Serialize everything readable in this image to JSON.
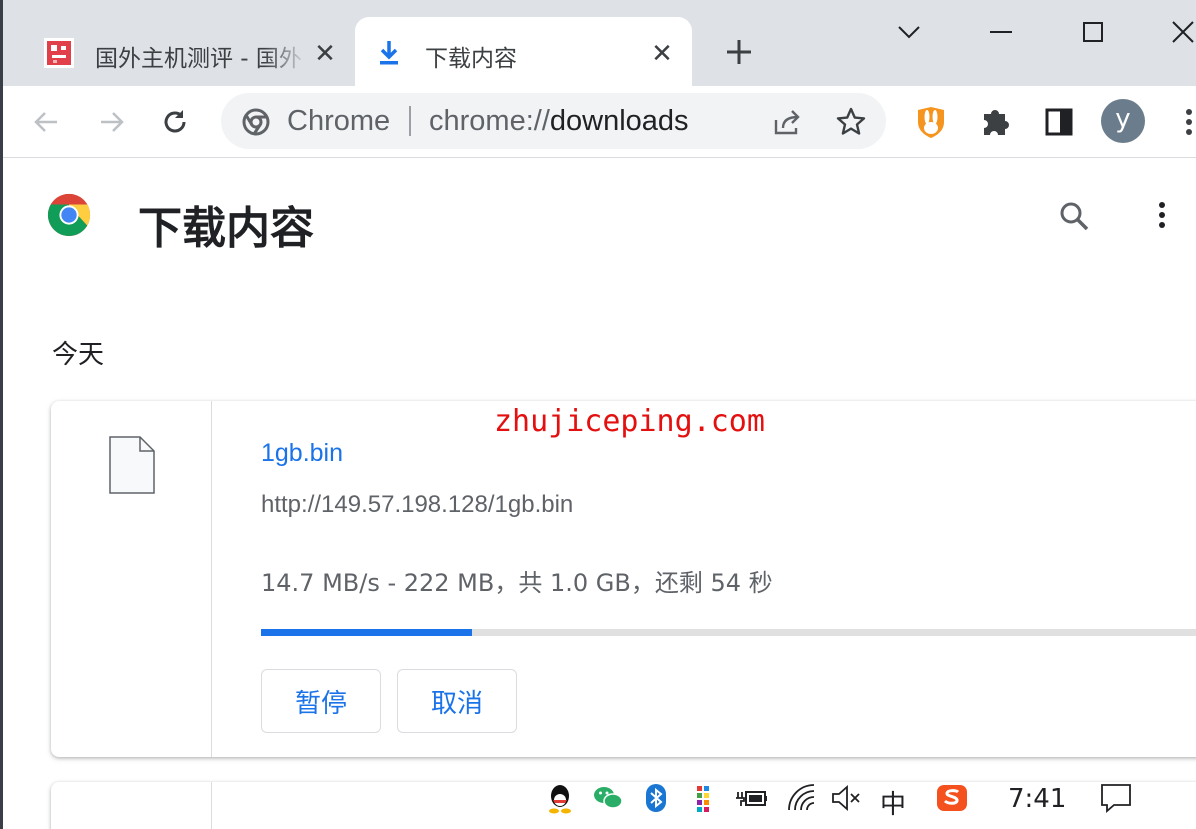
{
  "tabs": [
    {
      "title": "国外主机测评 - 国外",
      "active": false,
      "favicon": "site-favicon"
    },
    {
      "title": "下载内容",
      "active": true,
      "favicon": "download-icon"
    }
  ],
  "omnibox": {
    "chip": "Chrome",
    "url_scheme": "chrome://",
    "url_path": "downloads"
  },
  "profile": {
    "initial": "y"
  },
  "page": {
    "title": "下载内容",
    "date_heading": "今天"
  },
  "download": {
    "file_name": "1gb.bin",
    "url": "http://149.57.198.128/1gb.bin",
    "status": "14.7 MB/s - 222 MB，共 1.0 GB，还剩 54 秒",
    "progress_fraction": 0.222,
    "pause_label": "暂停",
    "cancel_label": "取消"
  },
  "watermark": "zhujiceping.com",
  "taskbar": {
    "ime": "中",
    "clock": "7:41"
  },
  "colors": {
    "accent": "#1a73e8",
    "tabstrip": "#dee1e6",
    "watermark": "#e3100f"
  }
}
